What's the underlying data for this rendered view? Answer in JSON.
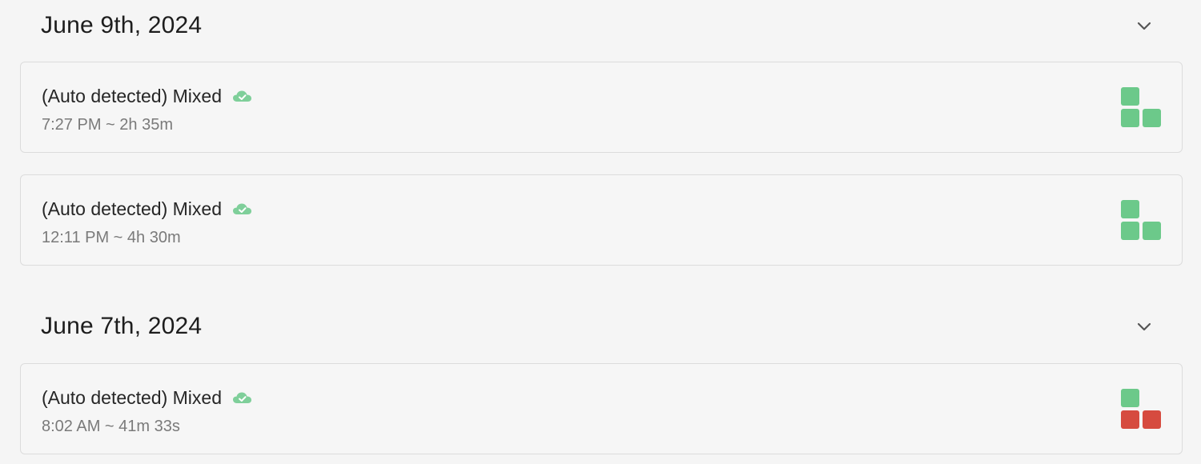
{
  "groups": [
    {
      "date": "June 9th, 2024",
      "sessions": [
        {
          "title": "(Auto detected) Mixed",
          "meta": "7:27 PM ~ 2h 35m",
          "tiles": [
            "green",
            "green",
            "green"
          ]
        },
        {
          "title": "(Auto detected) Mixed",
          "meta": "12:11 PM ~ 4h 30m",
          "tiles": [
            "green",
            "green",
            "green"
          ]
        }
      ]
    },
    {
      "date": "June 7th, 2024",
      "sessions": [
        {
          "title": "(Auto detected) Mixed",
          "meta": "8:02 AM ~ 41m 33s",
          "tiles": [
            "green",
            "red",
            "red"
          ]
        }
      ]
    }
  ],
  "icons": {
    "synced": "cloud-check-icon",
    "collapse": "chevron-down-icon"
  },
  "colors": {
    "green": "#6cc98a",
    "red": "#d64b3f",
    "synced_icon": "#7fcf9a"
  }
}
